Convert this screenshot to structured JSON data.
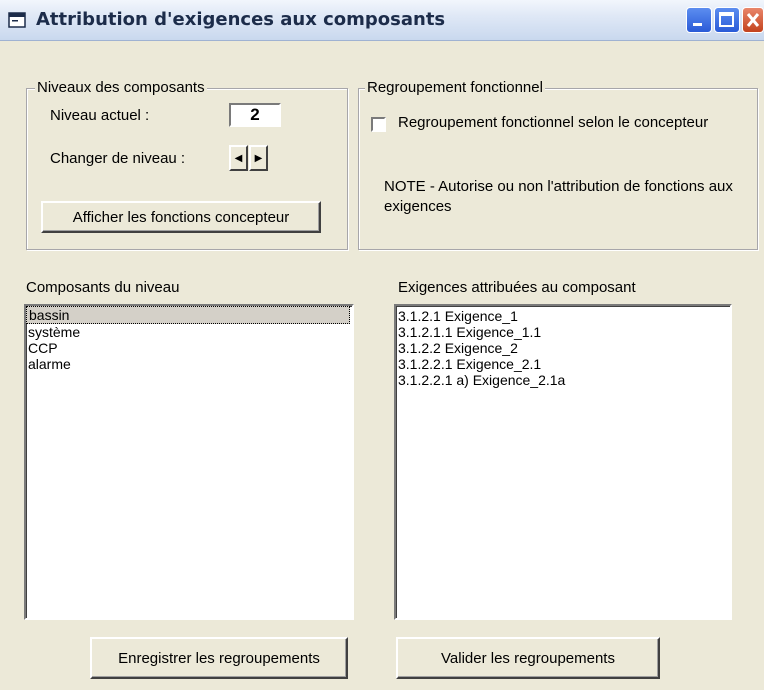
{
  "window": {
    "title": "Attribution d'exigences aux composants",
    "minimize_label": "_",
    "maximize_label": "□",
    "close_label": "X"
  },
  "niveaux": {
    "legend": "Niveaux des composants",
    "niveau_actuel_label": "Niveau actuel :",
    "niveau_actuel_value": "2",
    "changer_label": "Changer de niveau :",
    "spin_left": "◀",
    "spin_right": "▶",
    "afficher_button": "Afficher les fonctions concepteur"
  },
  "regroupement": {
    "legend": "Regroupement fonctionnel",
    "checkbox_label": "Regroupement fonctionnel selon le concepteur",
    "checkbox_checked": false,
    "note": "NOTE - Autorise ou non l'attribution de fonctions aux exigences"
  },
  "composants": {
    "label": "Composants du niveau",
    "items": [
      "bassin",
      "système",
      "CCP",
      "alarme"
    ],
    "selected_index": 0
  },
  "exigences": {
    "label": "Exigences attribuées au composant",
    "items": [
      "3.1.2.1 Exigence_1",
      "3.1.2.1.1 Exigence_1.1",
      "3.1.2.2 Exigence_2",
      "3.1.2.2.1 Exigence_2.1",
      "3.1.2.2.1 a)  Exigence_2.1a"
    ]
  },
  "footer": {
    "enregistrer_button": "Enregistrer les regroupements",
    "valider_button": "Valider les regroupements"
  }
}
